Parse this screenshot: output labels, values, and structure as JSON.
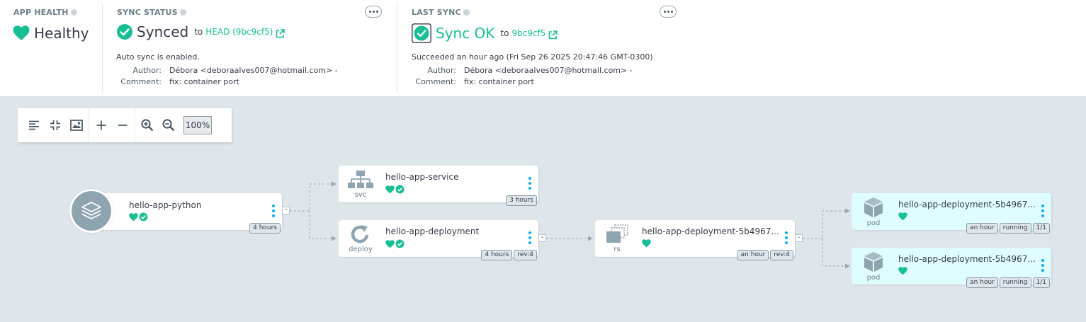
{
  "app_health": {
    "title": "APP HEALTH",
    "status": "Healthy"
  },
  "sync_status": {
    "title": "SYNC STATUS",
    "status": "Synced",
    "to_label": "to",
    "revision": "HEAD (9bc9cf5)",
    "auto_sync_text": "Auto sync is enabled.",
    "author_label": "Author:",
    "author_value": "Débora <deboraalves007@hotmail.com> -",
    "comment_label": "Comment:",
    "comment_value": "fix: container port"
  },
  "last_sync": {
    "title": "LAST SYNC",
    "status": "Sync OK",
    "to_label": "to",
    "revision": "9bc9cf5",
    "succeeded_text": "Succeeded an hour ago (Fri Sep 26 2025 20:47:46 GMT-0300)",
    "author_label": "Author:",
    "author_value": "Débora <deboraalves007@hotmail.com> -",
    "comment_label": "Comment:",
    "comment_value": "fix: container port"
  },
  "toolbar": {
    "zoom": "100%",
    "icons": [
      "list-view-icon",
      "fit-screen-icon",
      "minimap-icon",
      "expand-all-icon",
      "collapse-all-icon",
      "zoom-in-icon",
      "zoom-out-icon"
    ]
  },
  "graph": {
    "app": {
      "name": "hello-app-python",
      "age": "4 hours",
      "collapse": "-"
    },
    "service": {
      "name": "hello-app-service",
      "kind": "svc",
      "age": "3 hours"
    },
    "deployment": {
      "name": "hello-app-deployment",
      "kind": "deploy",
      "age": "4 hours",
      "rev": "rev:4",
      "collapse": "-"
    },
    "replicaset": {
      "name": "hello-app-deployment-5b4967...",
      "kind": "rs",
      "age": "an hour",
      "rev": "rev:4",
      "collapse": "-"
    },
    "pods": [
      {
        "name": "hello-app-deployment-5b4967...",
        "kind": "pod",
        "age": "an hour",
        "state": "running",
        "ready": "1/1"
      },
      {
        "name": "hello-app-deployment-5b4967...",
        "kind": "pod",
        "age": "an hour",
        "state": "running",
        "ready": "1/1"
      }
    ]
  },
  "colors": {
    "healthy": "#18be94",
    "accent_blue": "#0dadea",
    "icon_grey": "#8fa4b1",
    "background": "#dee6eb",
    "pod_background": "#e0fdfd"
  }
}
